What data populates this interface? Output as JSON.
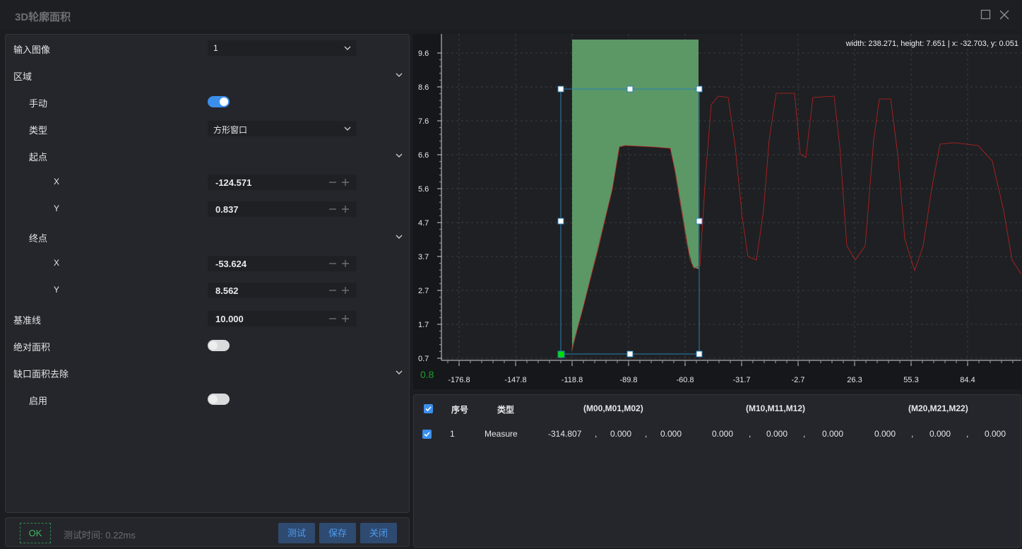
{
  "window": {
    "title": "3D轮廓面积"
  },
  "params": {
    "input_image": {
      "label": "输入图像",
      "value": "1"
    },
    "region": {
      "label": "区域"
    },
    "manual": {
      "label": "手动",
      "on": true
    },
    "type": {
      "label": "类型",
      "value": "方形窗口"
    },
    "start": {
      "label": "起点",
      "x_label": "X",
      "x": "-124.571",
      "y_label": "Y",
      "y": "0.837"
    },
    "end": {
      "label": "终点",
      "x_label": "X",
      "x": "-53.624",
      "y_label": "Y",
      "y": "8.562"
    },
    "baseline": {
      "label": "基准线",
      "value": "10.000"
    },
    "absolute_area": {
      "label": "绝对面积",
      "on": false
    },
    "notch_removal": {
      "label": "缺口面积去除"
    },
    "enable": {
      "label": "启用",
      "on": false
    }
  },
  "footer": {
    "status": "OK",
    "elapsed": "测试时间: 0.22ms",
    "test": "测试",
    "save": "保存",
    "close": "关闭"
  },
  "plot": {
    "info": "width: 238.271, height: 7.651 | x: -32.703, y: 0.051",
    "corner_value": "0.8",
    "y_ticks": [
      "9.6",
      "8.6",
      "7.6",
      "6.6",
      "5.6",
      "4.7",
      "3.7",
      "2.7",
      "1.7",
      "0.7"
    ],
    "x_ticks": [
      "-176.8",
      "-147.8",
      "-118.8",
      "-89.8",
      "-60.8",
      "-31.7",
      "-2.7",
      "26.3",
      "55.3",
      "84.4"
    ],
    "colors": {
      "profile": "#c02020",
      "area_fill": "#5f9f6a",
      "roi": "#2a7fb5",
      "start_handle": "#00e000"
    }
  },
  "table": {
    "headers": [
      "序号",
      "类型",
      "(M00,M01,M02)",
      "(M10,M11,M12)",
      "(M20,M21,M22)"
    ],
    "rows": [
      {
        "index": "1",
        "type": "Measure",
        "m0": [
          "-314.807",
          "0.000",
          "0.000"
        ],
        "m1": [
          "0.000",
          "0.000",
          "0.000"
        ],
        "m2": [
          "0.000",
          "0.000",
          "0.000"
        ],
        "sep": ","
      }
    ]
  }
}
